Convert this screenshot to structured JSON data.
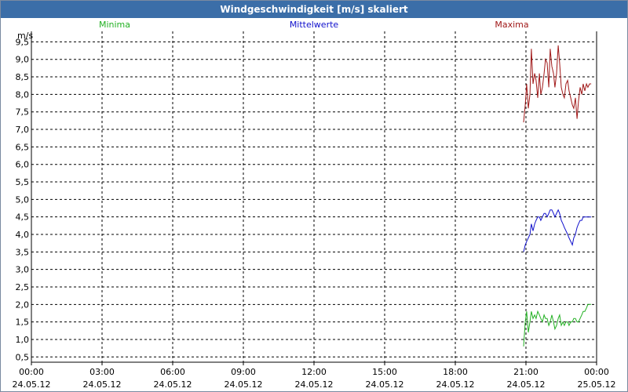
{
  "window": {
    "title": "Windgeschwindigkeit [m/s] skaliert"
  },
  "legend": {
    "minima": "Minima",
    "mittelwerte": "Mittelwerte",
    "maxima": "Maxima"
  },
  "colors": {
    "minima": "#22b022",
    "mittelwerte": "#1010cc",
    "maxima": "#a01818"
  },
  "chart_data": {
    "type": "line",
    "title": "Windgeschwindigkeit [m/s] skaliert",
    "ylabel": "m/s",
    "xlabel": "",
    "ylim": [
      0.35,
      9.8
    ],
    "yticks": [
      "0,5",
      "1,0",
      "1,5",
      "2,0",
      "2,5",
      "3,0",
      "3,5",
      "4,0",
      "4,5",
      "5,0",
      "5,5",
      "6,0",
      "6,5",
      "7,0",
      "7,5",
      "8,0",
      "8,5",
      "9,0",
      "9,5"
    ],
    "ytick_values": [
      0.5,
      1.0,
      1.5,
      2.0,
      2.5,
      3.0,
      3.5,
      4.0,
      4.5,
      5.0,
      5.5,
      6.0,
      6.5,
      7.0,
      7.5,
      8.0,
      8.5,
      9.0,
      9.5
    ],
    "xticks": [
      {
        "time": "00:00",
        "date": "24.05.12"
      },
      {
        "time": "03:00",
        "date": "24.05.12"
      },
      {
        "time": "06:00",
        "date": "24.05.12"
      },
      {
        "time": "09:00",
        "date": "24.05.12"
      },
      {
        "time": "12:00",
        "date": "24.05.12"
      },
      {
        "time": "15:00",
        "date": "24.05.12"
      },
      {
        "time": "18:00",
        "date": "24.05.12"
      },
      {
        "time": "21:00",
        "date": "24.05.12"
      },
      {
        "time": "00:00",
        "date": "25.05.12"
      }
    ],
    "xtick_hours": [
      0,
      3,
      6,
      9,
      12,
      15,
      18,
      21,
      24
    ],
    "xlim_hours": [
      0,
      24
    ],
    "x_hours": [
      20.9,
      20.97,
      21.03,
      21.1,
      21.17,
      21.23,
      21.3,
      21.37,
      21.43,
      21.5,
      21.57,
      21.63,
      21.7,
      21.77,
      21.83,
      21.9,
      21.97,
      22.03,
      22.1,
      22.17,
      22.23,
      22.3,
      22.37,
      22.43,
      22.5,
      22.57,
      22.63,
      22.7,
      22.77,
      22.83,
      22.9,
      22.97,
      23.03,
      23.1,
      23.17,
      23.23,
      23.3,
      23.37,
      23.43,
      23.5,
      23.57,
      23.63,
      23.7,
      23.77
    ],
    "series": [
      {
        "name": "Maxima",
        "color": "#a01818",
        "values": [
          7.2,
          7.7,
          8.3,
          7.6,
          8.0,
          9.3,
          8.3,
          8.6,
          8.4,
          7.9,
          8.6,
          8.0,
          8.2,
          8.6,
          9.0,
          8.9,
          8.2,
          9.3,
          8.8,
          8.6,
          8.2,
          8.6,
          9.4,
          8.9,
          8.2,
          8.0,
          7.9,
          8.3,
          8.4,
          8.1,
          7.9,
          7.7,
          7.6,
          7.9,
          7.3,
          7.8,
          8.2,
          8.0,
          8.3,
          8.1,
          8.3,
          8.2,
          8.3,
          8.3
        ],
        "note_hidden": true
      },
      {
        "name": "Mittelwerte",
        "color": "#1010cc",
        "values": [
          3.5,
          3.7,
          3.8,
          3.9,
          4.0,
          4.3,
          4.1,
          4.3,
          4.4,
          4.5,
          4.5,
          4.4,
          4.5,
          4.6,
          4.6,
          4.5,
          4.6,
          4.7,
          4.7,
          4.6,
          4.5,
          4.6,
          4.7,
          4.6,
          4.4,
          4.3,
          4.2,
          4.1,
          4.0,
          3.9,
          3.8,
          3.7,
          3.9,
          4.0,
          4.2,
          4.3,
          4.4,
          4.4,
          4.5,
          4.5,
          4.5,
          4.5,
          4.5,
          4.5
        ]
      },
      {
        "name": "Minima",
        "color": "#22b022",
        "values": [
          0.8,
          1.5,
          1.8,
          1.2,
          1.5,
          1.8,
          1.6,
          1.7,
          1.6,
          1.8,
          1.7,
          1.6,
          1.5,
          1.7,
          1.6,
          1.6,
          1.4,
          1.5,
          1.7,
          1.5,
          1.3,
          1.4,
          1.6,
          1.7,
          1.4,
          1.5,
          1.4,
          1.5,
          1.5,
          1.4,
          1.5,
          1.5,
          1.6,
          1.6,
          1.5,
          1.5,
          1.6,
          1.7,
          1.8,
          1.8,
          1.9,
          2.0,
          2.0,
          2.0
        ]
      }
    ],
    "grid": true,
    "legend_placement": "top"
  }
}
